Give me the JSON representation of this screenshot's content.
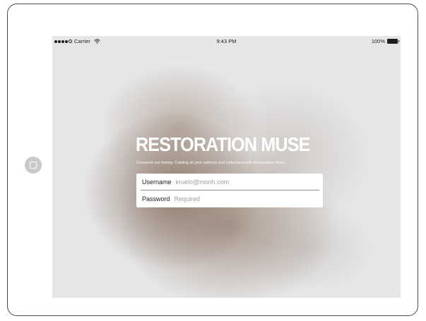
{
  "status_bar": {
    "carrier": "Carrier",
    "time": "9:43 PM",
    "battery": "100%"
  },
  "app": {
    "title": "RESTORATION MUSE",
    "tagline": "Conserve our history. Catalog all your artifacts and collections with Restoration Muse."
  },
  "login_form": {
    "username_label": "Username",
    "username_value": "kruelo@monh.com",
    "password_label": "Password",
    "password_placeholder": "Required"
  }
}
